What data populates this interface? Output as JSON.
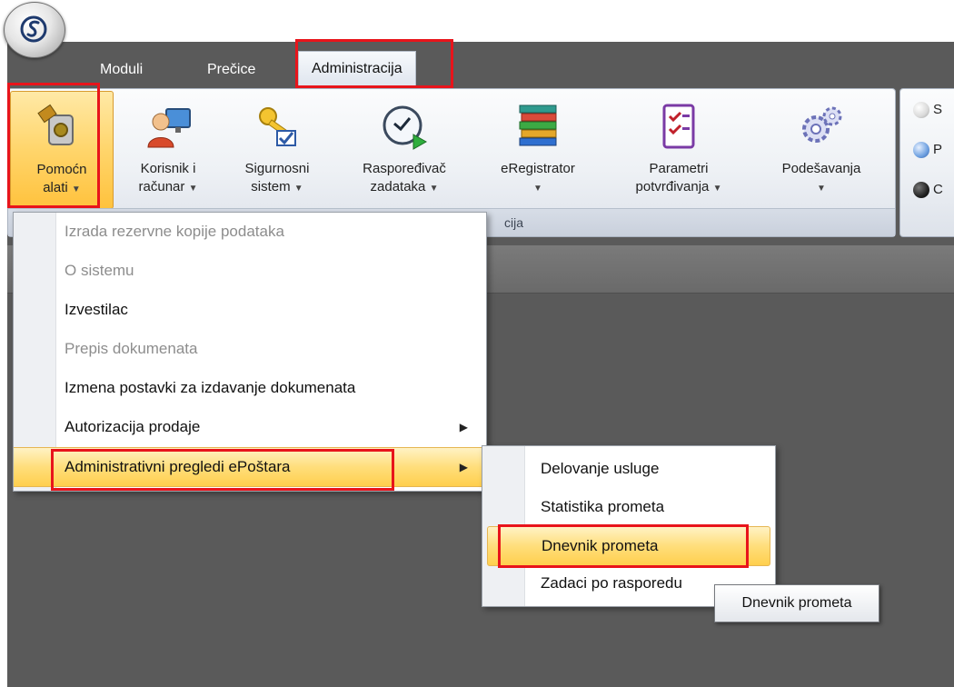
{
  "tabs": [
    {
      "label": "Moduli"
    },
    {
      "label": "Prečice"
    },
    {
      "label": "Administracija"
    }
  ],
  "ribbon": {
    "group_label": "cija",
    "buttons": [
      {
        "line1": "Pomoćn",
        "line2": "alati",
        "icon": "tool-plug-icon"
      },
      {
        "line1": "Korisnik i",
        "line2": "računar",
        "icon": "user-computer-icon"
      },
      {
        "line1": "Sigurnosni",
        "line2": "sistem",
        "icon": "key-check-icon"
      },
      {
        "line1": "Raspoređivač",
        "line2": "zadataka",
        "icon": "clock-play-icon"
      },
      {
        "line1": "eRegistrator",
        "line2": "",
        "icon": "books-icon"
      },
      {
        "line1": "Parametri",
        "line2": "potvrđivanja",
        "icon": "checklist-icon"
      },
      {
        "line1": "Podešavanja",
        "line2": "",
        "icon": "gears-icon"
      }
    ],
    "side_items": [
      {
        "label": "S",
        "color": "#d9d9d9"
      },
      {
        "label": "P",
        "color": "#6ea0e0"
      },
      {
        "label": "C",
        "color": "#222222"
      }
    ]
  },
  "menu": {
    "items": [
      {
        "label": "Izrada rezervne kopije podataka",
        "enabled": false
      },
      {
        "label": "O sistemu",
        "enabled": false
      },
      {
        "label": "Izvestilac",
        "enabled": true
      },
      {
        "label": "Prepis dokumenata",
        "enabled": false
      },
      {
        "label": "Izmena postavki za izdavanje dokumenata",
        "enabled": true
      },
      {
        "label": "Autorizacija prodaje",
        "enabled": true
      },
      {
        "label": "Administrativni pregledi ePoštara",
        "enabled": true
      }
    ]
  },
  "submenu": {
    "items": [
      {
        "label": "Delovanje usluge"
      },
      {
        "label": "Statistika prometa"
      },
      {
        "label": "Dnevnik prometa"
      },
      {
        "label": "Zadaci po rasporedu"
      }
    ]
  },
  "tooltip": {
    "text": "Dnevnik prometa"
  },
  "colors": {
    "highlight_box": "#e8141b",
    "menu_highlight": "#ffde7b",
    "workspace": "#5a5a5a"
  }
}
